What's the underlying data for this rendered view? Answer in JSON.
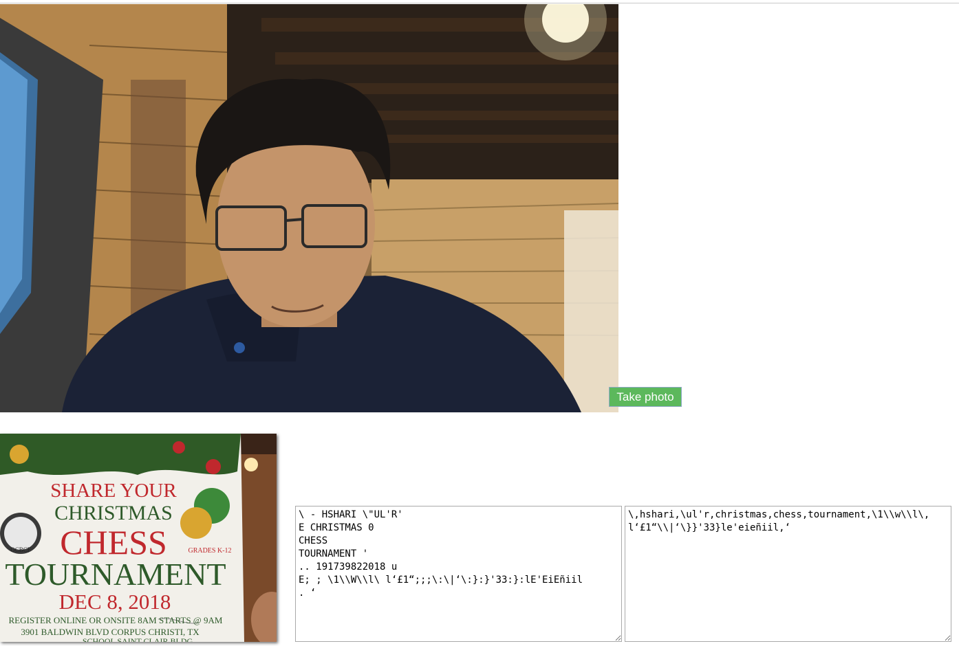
{
  "capture": {
    "button_label": "Take photo"
  },
  "photo": {
    "flyer": {
      "line1": "SHARE YOUR",
      "line2": "CHRISTMAS",
      "line3": "CHESS",
      "line4": "TOURNAMENT",
      "date": "DEC 8, 2018",
      "grades": "GRADES K-12",
      "register": "REGISTER ONLINE  OR ONSITE 8AM STARTS @ 9AM",
      "address": "3901 BALDWIN BLVD CORPUS CHRISTI, TX",
      "venue": "SCHOOL SAINT CLAIR BLDG",
      "logo": "OCBCF"
    }
  },
  "ocr": {
    "raw_text": "\\ - HSHARI \\\"UL'R'\nE CHRISTMAS 0\nCHESS\nTOURNAMENT '\n.. 191739822018 u\nE; ; \\1\\\\W\\\\l\\ l‘£1“;;;\\:\\|‘\\:}:}'33:}:lE'EiEñiil\n. ‘",
    "tags_text": "\\,hshari,\\ul'r,christmas,chess,tournament,\\1\\\\w\\\\l\\,l‘£1“\\\\|‘\\}}'33}le'eieñiil,‘"
  },
  "colors": {
    "button_bg": "#5cb85c",
    "button_border": "#8fa8c8",
    "flyer_red": "#c0282d",
    "flyer_green": "#2e5a2a"
  }
}
